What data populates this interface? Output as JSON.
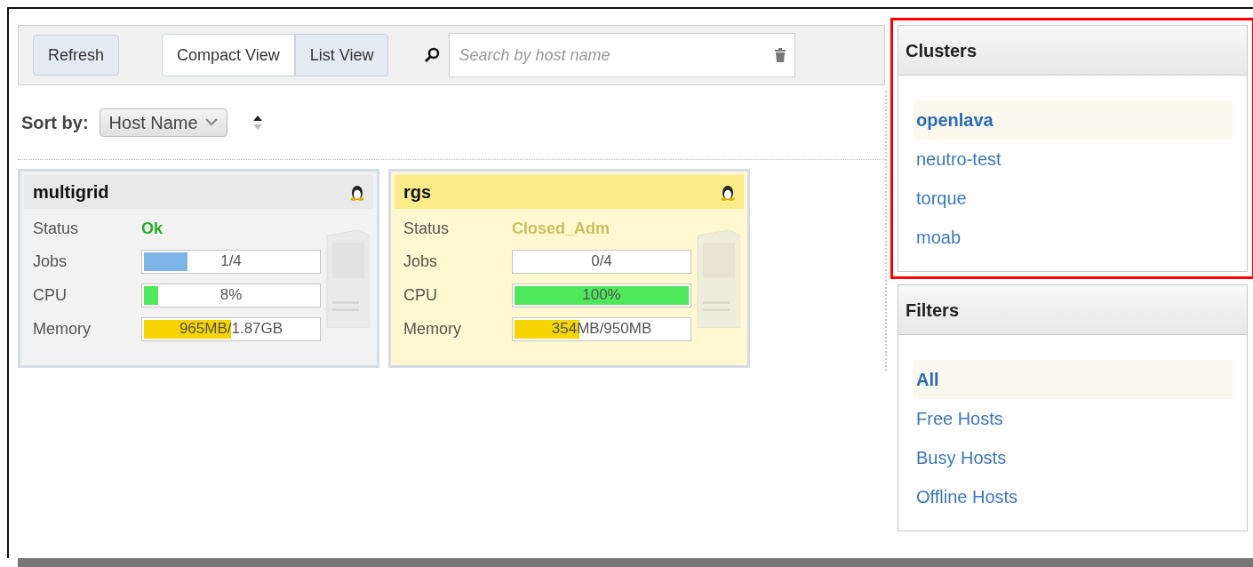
{
  "toolbar": {
    "refresh": "Refresh",
    "views": [
      {
        "label": "Compact View",
        "selected": true
      },
      {
        "label": "List View",
        "selected": false
      }
    ],
    "search": {
      "placeholder": "Search by host name"
    }
  },
  "sort": {
    "label": "Sort by:",
    "value": "Host Name"
  },
  "hosts": [
    {
      "name": "multigrid",
      "kind": "ok",
      "status_label": "Status",
      "status": "Ok",
      "metrics": [
        {
          "kind": "jobs",
          "label": "Jobs",
          "reading": "1/4",
          "level": 0.25
        },
        {
          "kind": "cpu",
          "label": "CPU",
          "reading": "8%",
          "level": 0.08
        },
        {
          "kind": "memory",
          "label": "Memory",
          "reading": "965MB/1.87GB",
          "level": 0.5
        }
      ]
    },
    {
      "name": "rgs",
      "kind": "closed",
      "status_label": "Status",
      "status": "Closed_Adm",
      "metrics": [
        {
          "kind": "jobs",
          "label": "Jobs",
          "reading": "0/4",
          "level": 0
        },
        {
          "kind": "cpu",
          "label": "CPU",
          "reading": "100%",
          "level": 1
        },
        {
          "kind": "memory",
          "label": "Memory",
          "reading": "354MB/950MB",
          "level": 0.37
        }
      ]
    }
  ],
  "clusters": {
    "title": "Clusters",
    "highlighted": true,
    "items": [
      {
        "label": "openlava",
        "selected": true
      },
      {
        "label": "neutro-test",
        "selected": false
      },
      {
        "label": "torque",
        "selected": false
      },
      {
        "label": "moab",
        "selected": false
      }
    ]
  },
  "filters": {
    "title": "Filters",
    "items": [
      {
        "label": "All",
        "selected": true
      },
      {
        "label": "Free Hosts",
        "selected": false
      },
      {
        "label": "Busy Hosts",
        "selected": false
      },
      {
        "label": "Offline Hosts",
        "selected": false
      }
    ]
  }
}
